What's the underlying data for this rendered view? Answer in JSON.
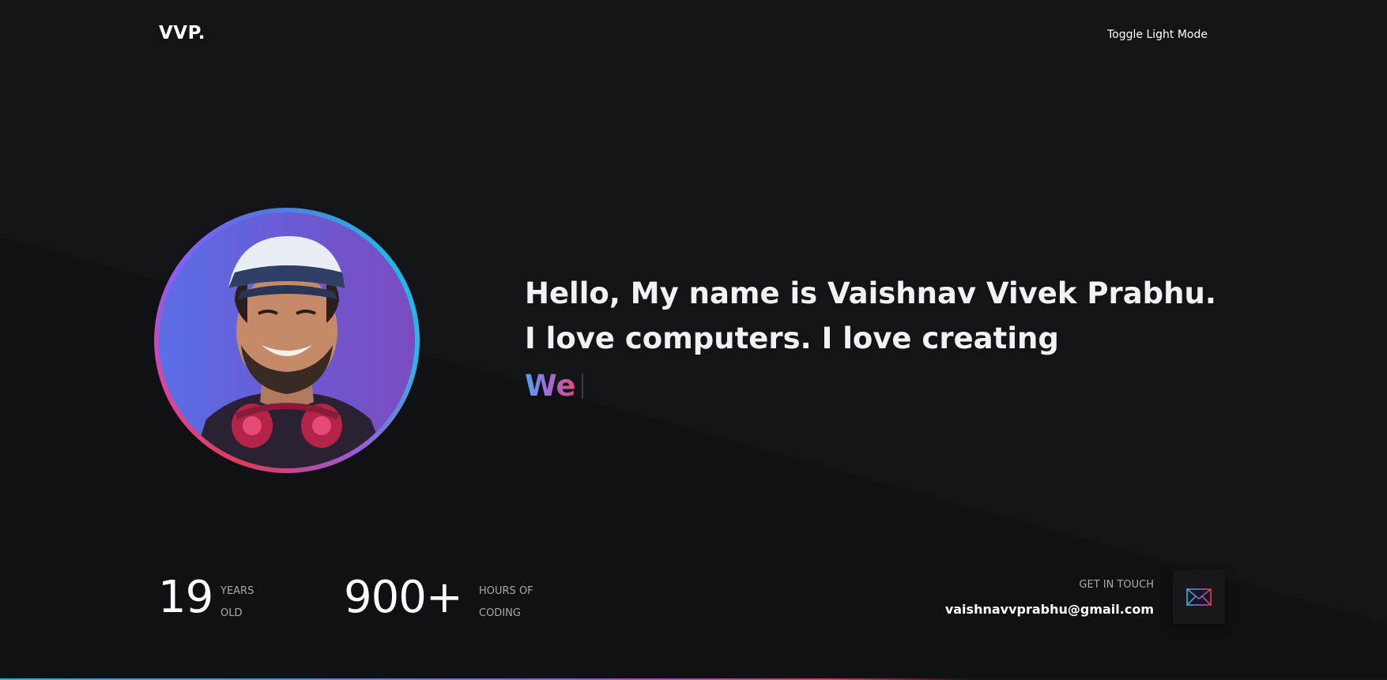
{
  "header": {
    "logo": "VVP.",
    "toggle_label": "Toggle Light Mode"
  },
  "hero": {
    "intro": "Hello, My name is Vaishnav Vivek Prabhu. I love computers. I love creating",
    "typed_text": "We",
    "avatar_alt": "profile-photo"
  },
  "stats": [
    {
      "number": "19",
      "label_line1": "YEARS",
      "label_line2": "OLD"
    },
    {
      "number": "900+",
      "label_line1": "HOURS OF",
      "label_line2": "CODING"
    }
  ],
  "contact": {
    "label": "GET IN TOUCH",
    "email": "vaishnavvprabhu@gmail.com",
    "icon": "mail-icon"
  },
  "colors": {
    "background": "#131417",
    "text": "#ffffff",
    "muted": "#a7a9ad",
    "gradient_blue": "#4fa3f0",
    "gradient_purple": "#a06bd8",
    "gradient_pink": "#e24a76"
  }
}
